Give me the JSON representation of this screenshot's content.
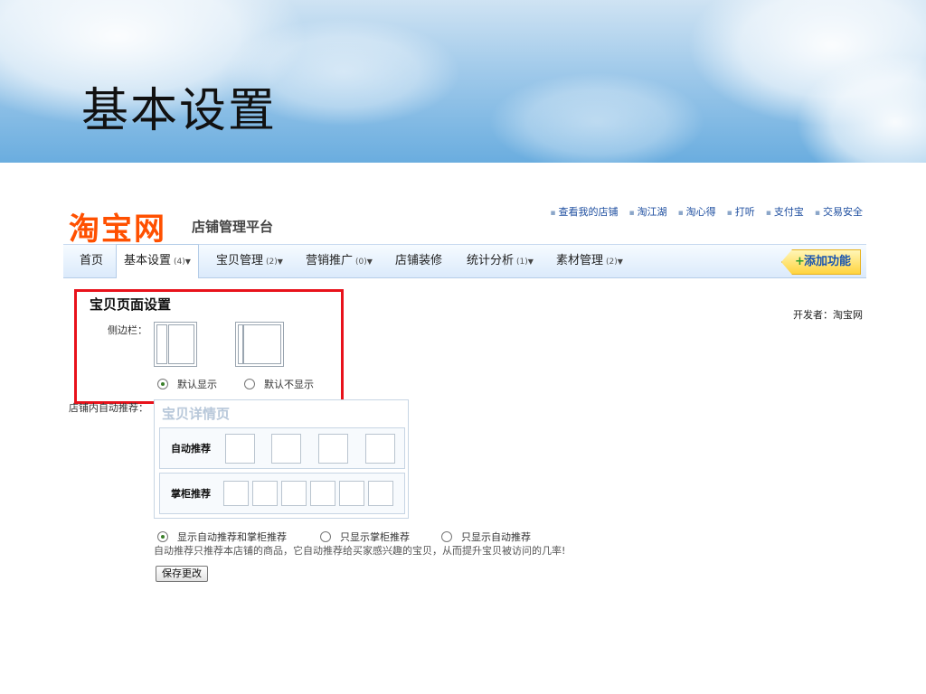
{
  "slide": {
    "title": "基本设置"
  },
  "header": {
    "logo": "淘宝网",
    "platform": "店铺管理平台",
    "top_links": [
      "查看我的店铺",
      "淘江湖",
      "淘心得",
      "打听",
      "支付宝",
      "交易安全"
    ]
  },
  "nav": {
    "items": [
      {
        "label": "首页",
        "count": "",
        "dropdown": false
      },
      {
        "label": "基本设置",
        "count": "(4)",
        "dropdown": true,
        "active": true
      },
      {
        "label": "宝贝管理",
        "count": "(2)",
        "dropdown": true
      },
      {
        "label": "营销推广",
        "count": "(0)",
        "dropdown": true
      },
      {
        "label": "店铺装修",
        "count": "",
        "dropdown": false
      },
      {
        "label": "统计分析",
        "count": "(1)",
        "dropdown": true
      },
      {
        "label": "素材管理",
        "count": "(2)",
        "dropdown": true
      }
    ],
    "add_feature": "添加功能"
  },
  "developer": "开发者：淘宝网",
  "item_page_settings": {
    "title": "宝贝页面设置",
    "sidebar_label": "侧边栏：",
    "sidebar_options": [
      {
        "label": "默认显示",
        "selected": true
      },
      {
        "label": "默认不显示",
        "selected": false
      }
    ]
  },
  "recommend": {
    "label": "店铺内自动推荐：",
    "panel_title": "宝贝详情页",
    "auto_row_label": "自动推荐",
    "counter_row_label": "掌柜推荐",
    "options": [
      {
        "label": "显示自动推荐和掌柜推荐",
        "selected": true
      },
      {
        "label": "只显示掌柜推荐",
        "selected": false
      },
      {
        "label": "只显示自动推荐",
        "selected": false
      }
    ],
    "tip": "自动推荐只推荐本店铺的商品，它自动推荐给买家感兴趣的宝贝，从而提升宝贝被访问的几率!"
  },
  "save_button": "保存更改",
  "colors": {
    "logo": "#ff5000",
    "highlight_border": "#e8121b",
    "link": "#1f4fa0",
    "add_button": "#ffd43f"
  }
}
